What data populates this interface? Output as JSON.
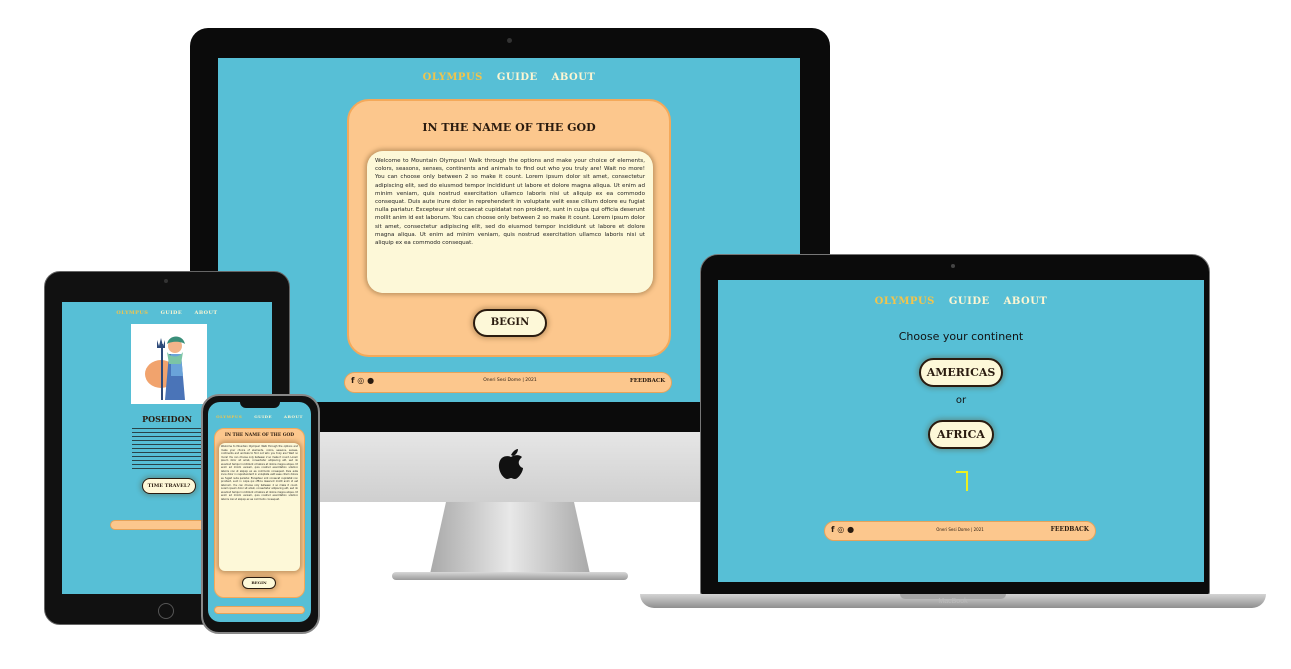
{
  "nav": {
    "home": "OLYMPUS",
    "guide": "GUIDE",
    "about": "ABOUT"
  },
  "intro": {
    "title": "IN THE NAME OF THE GOD",
    "body": "Welcome to Mountain Olympus! Walk through the options and make your choice of elements, colors, seasons, senses, continents and animals to find out who you truly are! Wait no more! You can choose only between 2 so make it count. Lorem ipsum dolor sit amet, consectetur adipiscing elit, sed do eiusmod tempor incididunt ut labore et dolore magna aliqua. Ut enim ad minim veniam, quis nostrud exercitation ullamco laboris nisi ut aliquip ex ea commodo consequat. Duis aute irure dolor in reprehenderit in voluptate velit esse cillum dolore eu fugiat nulla pariatur. Excepteur sint occaecat cupidatat non proident, sunt in culpa qui officia deserunt mollit anim id est laborum. You can choose only between 2 so make it count. Lorem ipsum dolor sit amet, consectetur adipiscing elit, sed do eiusmod tempor incididunt ut labore et dolore magna aliqua. Ut enim ad minim veniam, quis nostrud exercitation ullamco laboris nisi ut aliquip ex ea commodo consequat.",
    "begin": "BEGIN"
  },
  "footer": {
    "credit": "Oneri Sesi Dome | 2021",
    "feedback": "FEEDBACK"
  },
  "continent": {
    "prompt": "Choose your continent",
    "option1": "AMERICAS",
    "or": "or",
    "option2": "AFRICA"
  },
  "god": {
    "name": "POSEIDON",
    "time_travel": "TIME TRAVEL?"
  },
  "laptop_brand": "MacBook",
  "colors": {
    "accent": "#57bfd6",
    "card": "#fcc78d",
    "cream": "#fdf8d8",
    "gold": "#f2c44b"
  }
}
